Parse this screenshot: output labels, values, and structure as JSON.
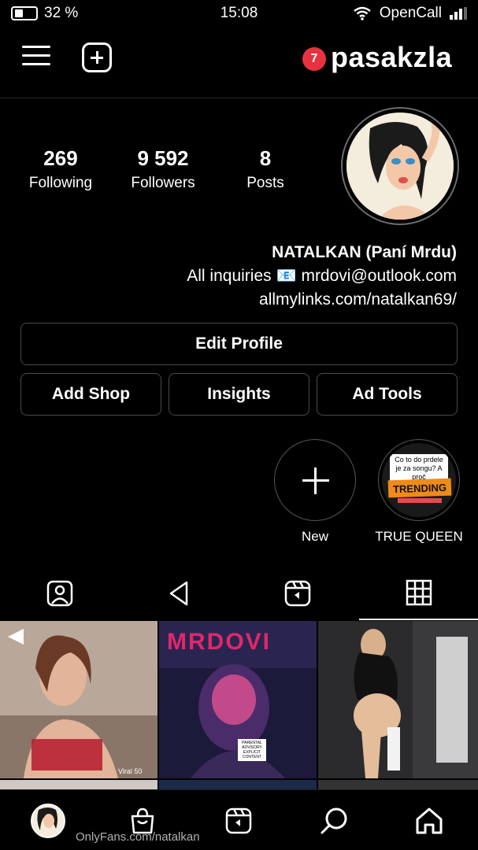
{
  "status_bar": {
    "battery_percent": "32 %",
    "time": "15:08",
    "carrier": "OpenCall"
  },
  "header": {
    "username": "pasakzla",
    "notification_count": "7"
  },
  "stats": {
    "posts": {
      "value": "8",
      "label": "Posts"
    },
    "followers": {
      "value": "9 592",
      "label": "Followers"
    },
    "following": {
      "value": "269",
      "label": "Following"
    }
  },
  "bio": {
    "name": "NATALKAN (Paní Mrdu)",
    "line1": "All inquiries 📧 mrdovi@outlook.com",
    "link": "allmylinks.com/natalkan69/"
  },
  "buttons": {
    "edit_profile": "Edit Profile",
    "ad_tools": "Ad Tools",
    "insights": "Insights",
    "add_shop": "Add Shop"
  },
  "highlights": [
    {
      "label": "TRUE QUEEN",
      "caption_text": "Co to do prdele je za songu? A proč",
      "tag": "TRENDING"
    },
    {
      "label": "New"
    }
  ],
  "tabs": [
    {
      "icon": "grid-icon",
      "active": true
    },
    {
      "icon": "reels-icon",
      "active": false
    },
    {
      "icon": "play-icon",
      "active": false
    },
    {
      "icon": "tagged-icon",
      "active": false
    }
  ],
  "grid": {
    "post2_overlay_title": "MRDOVI",
    "post2_advisory": "PARENTAL ADVISORY EXPLICIT CONTENT",
    "post1_caption": "Viral 50"
  },
  "bottom_nav": [
    "home-icon",
    "search-icon",
    "reels-icon",
    "shop-icon",
    "profile-avatar"
  ],
  "watermark": "OnlyFans.com/natalkan",
  "colors": {
    "background": "#000000",
    "badge": "#e8323f",
    "border": "#4a4a4a",
    "trending": "#f08a18"
  }
}
